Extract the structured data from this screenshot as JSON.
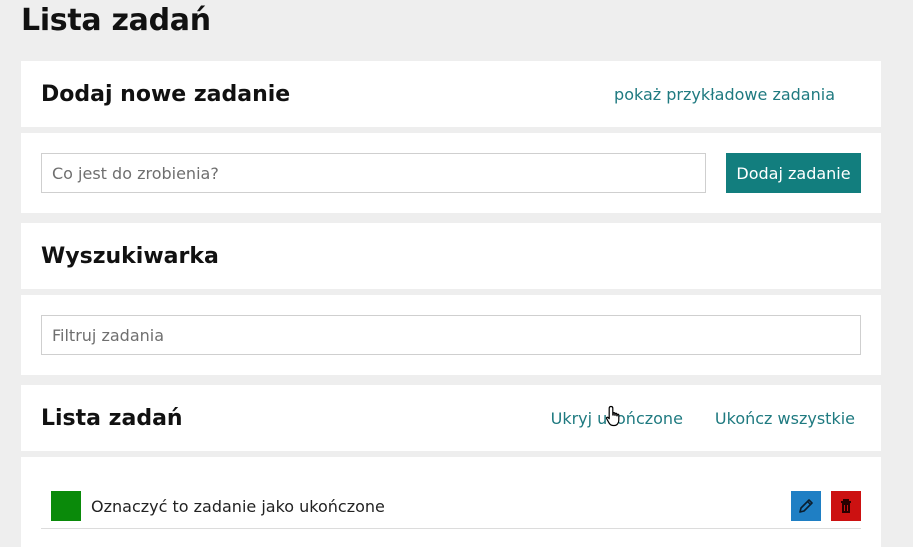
{
  "page_title": "Lista zadań",
  "add_section": {
    "title": "Dodaj nowe zadanie",
    "sample_link": "pokaż przykładowe zadania",
    "input_placeholder": "Co jest do zrobienia?",
    "input_value": "",
    "add_button": "Dodaj zadanie"
  },
  "search_section": {
    "title": "Wyszukiwarka",
    "filter_placeholder": "Filtruj zadania",
    "filter_value": ""
  },
  "list_section": {
    "title": "Lista zadań",
    "hide_done_link": "Ukryj ukończone",
    "complete_all_link": "Ukończ wszystkie",
    "tasks": [
      {
        "text": "Oznaczyć to zadanie jako ukończone",
        "done_color": "#0a8a0a"
      }
    ]
  },
  "colors": {
    "accent": "#127e7e",
    "link": "#1f7a80",
    "edit": "#1f7fc4",
    "delete": "#cc1111",
    "background": "#eeeeee"
  },
  "icons": {
    "edit": "pencil-icon",
    "delete": "trash-icon",
    "cursor": "hand-pointer-icon"
  }
}
